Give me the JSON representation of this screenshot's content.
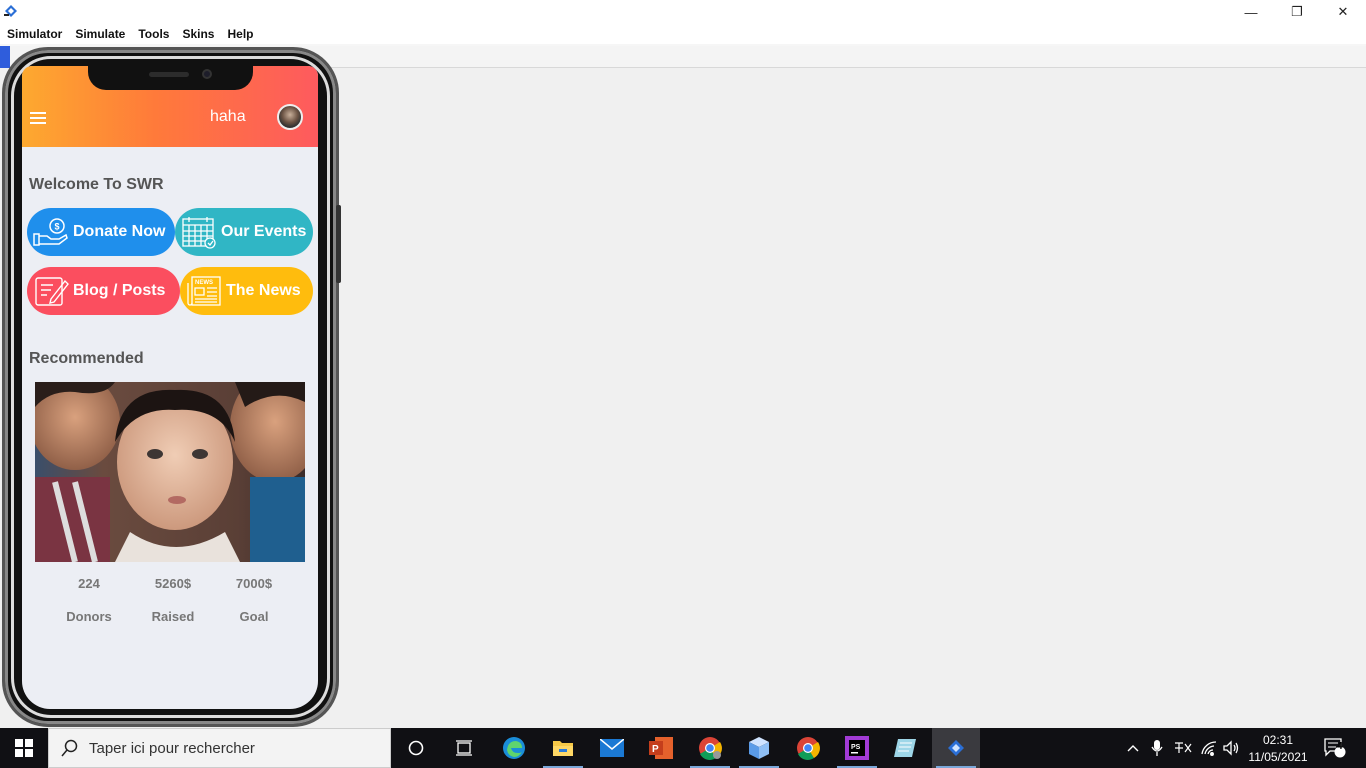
{
  "window": {
    "app_icon": "simulator-app-icon",
    "controls": {
      "minimize": "—",
      "restore": "❐",
      "close": "✕"
    }
  },
  "menu": [
    "Simulator",
    "Simulate",
    "Tools",
    "Skins",
    "Help"
  ],
  "app": {
    "header_title": "haha",
    "welcome": "Welcome To SWR",
    "buttons": [
      {
        "label": "Donate Now",
        "color": "#1f8fec",
        "icon": "donate-hand-icon"
      },
      {
        "label": "Our Events",
        "color": "#30b6c5",
        "icon": "calendar-icon"
      },
      {
        "label": "Blog / Posts",
        "color": "#fb4e5f",
        "icon": "edit-note-icon"
      },
      {
        "label": "The News",
        "color": "#ffbc0d",
        "icon": "newspaper-icon"
      }
    ],
    "recommended": "Recommended",
    "stats": [
      {
        "value": "224",
        "label": "Donors"
      },
      {
        "value": "5260$",
        "label": "Raised"
      },
      {
        "value": "7000$",
        "label": "Goal"
      }
    ]
  },
  "taskbar": {
    "search_placeholder": "Taper ici pour rechercher",
    "time": "02:31",
    "date": "11/05/2021",
    "notifications": "4"
  }
}
